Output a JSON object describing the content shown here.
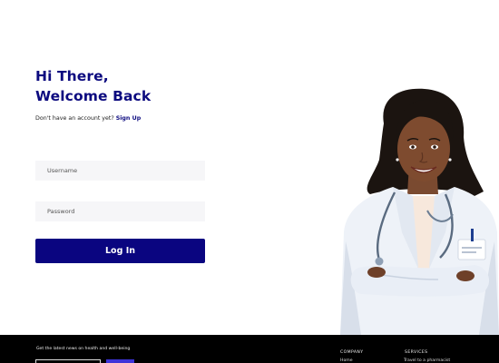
{
  "greeting": {
    "line1": "Hi There,",
    "line2": "Welcome Back"
  },
  "signup": {
    "prompt": "Don't have an account yet?",
    "link_label": "Sign Up"
  },
  "form": {
    "username_placeholder": "Username",
    "password_placeholder": "Password",
    "login_label": "Log In"
  },
  "footer": {
    "newsletter_text": "Get the latest news on health and well-being",
    "company": {
      "heading": "COMPANY",
      "items": [
        "Home"
      ]
    },
    "services": {
      "heading": "SERVICES",
      "items": [
        "Travel to a pharmacist"
      ]
    }
  },
  "colors": {
    "brand": "#0c0a7f",
    "button": "#0a0580",
    "field_bg": "#f6f6f8",
    "footer_bg": "#000000",
    "newsletter_button": "#3e34d8"
  },
  "icons": {
    "hero_image": "doctor-illustration"
  }
}
